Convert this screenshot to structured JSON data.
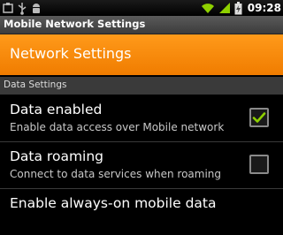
{
  "status_bar": {
    "time": "09:28",
    "icons_left": [
      "box-icon",
      "usb-icon",
      "android-debug-icon"
    ],
    "icons_right": [
      "wifi-icon",
      "signal-icon",
      "battery-charging-icon"
    ]
  },
  "window": {
    "title": "Mobile Network Settings"
  },
  "header": {
    "title": "Network Settings"
  },
  "section": {
    "label": "Data Settings"
  },
  "preferences": [
    {
      "title": "Data enabled",
      "summary": "Enable data access over Mobile network",
      "checked": true
    },
    {
      "title": "Data roaming",
      "summary": "Connect to data services when roaming",
      "checked": false
    },
    {
      "title": "Enable always-on mobile data",
      "summary": "",
      "checked": false
    }
  ],
  "colors": {
    "accent": "#ff8c00",
    "check": "#8ed000"
  }
}
